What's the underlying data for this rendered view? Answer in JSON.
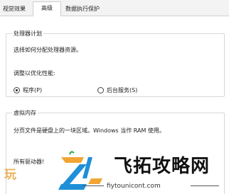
{
  "tabs": [
    {
      "label": "视觉效果"
    },
    {
      "label": "高级"
    },
    {
      "label": "数据执行保护"
    }
  ],
  "processor_scheduling": {
    "legend": "处理器计划",
    "description": "选择如何分配处理器资源。",
    "adjust_label": "调整以优化性能:",
    "options": [
      {
        "label": "程序(P)",
        "selected": true
      },
      {
        "label": "后台服务(S)",
        "selected": false
      }
    ]
  },
  "virtual_memory": {
    "legend": "虚拟内存",
    "description": "分页文件是硬盘上的一块区域。Windows 当作 RAM 使用。",
    "drives_label": "所有驱动器!"
  },
  "watermark": {
    "left_text": "玩",
    "title": "飞拓攻略网",
    "url": "fiytounicont.com"
  }
}
